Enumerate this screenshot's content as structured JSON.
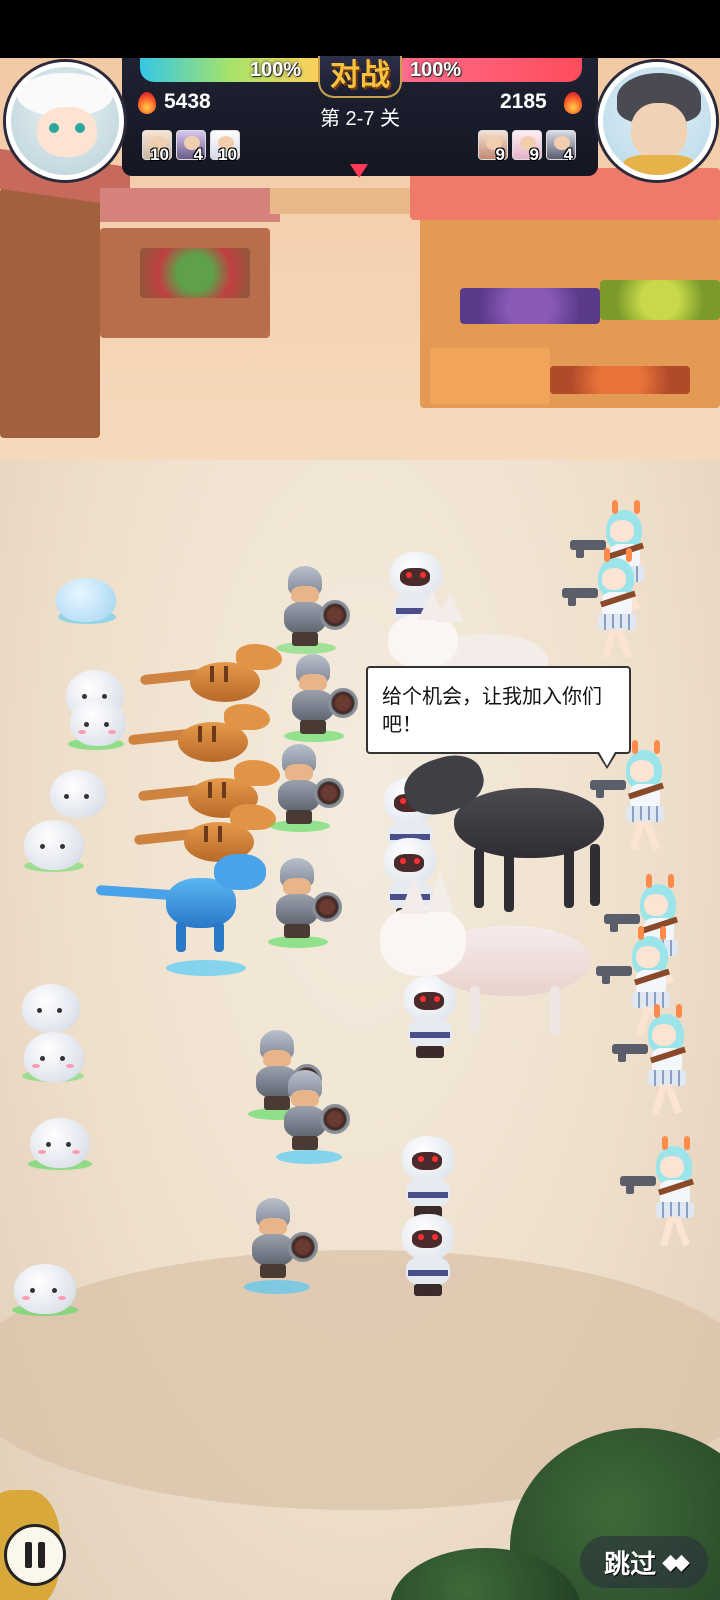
{
  "hud": {
    "vs_label": "对战",
    "stage_label": "第 2-7 关",
    "player": {
      "hp_percent": "100%",
      "power": "5438",
      "hp_fraction": 1.0,
      "team": [
        {
          "icon": "bear-unit-icon",
          "count": "10"
        },
        {
          "icon": "dark-hair-unit-icon",
          "count": "4"
        },
        {
          "icon": "white-hair-unit-icon",
          "count": "10"
        }
      ]
    },
    "enemy": {
      "hp_percent": "100%",
      "power": "2185",
      "hp_fraction": 1.0,
      "team": [
        {
          "icon": "hood-unit-icon",
          "count": "9"
        },
        {
          "icon": "pink-hair-unit-icon",
          "count": "9"
        },
        {
          "icon": "dark-hair-unit-icon",
          "count": "4"
        }
      ]
    }
  },
  "dialog": {
    "text": "给个机会，让我加入你们吧！"
  },
  "controls": {
    "skip_label": "跳过",
    "skip_arrows": "◆◆",
    "pause_icon": "pause-icon"
  },
  "colors": {
    "player_hp": "#34c7e6",
    "enemy_hp": "#ff4c5c",
    "power_fire": "#ff6a2a",
    "vs_gold": "#f6c23c"
  }
}
